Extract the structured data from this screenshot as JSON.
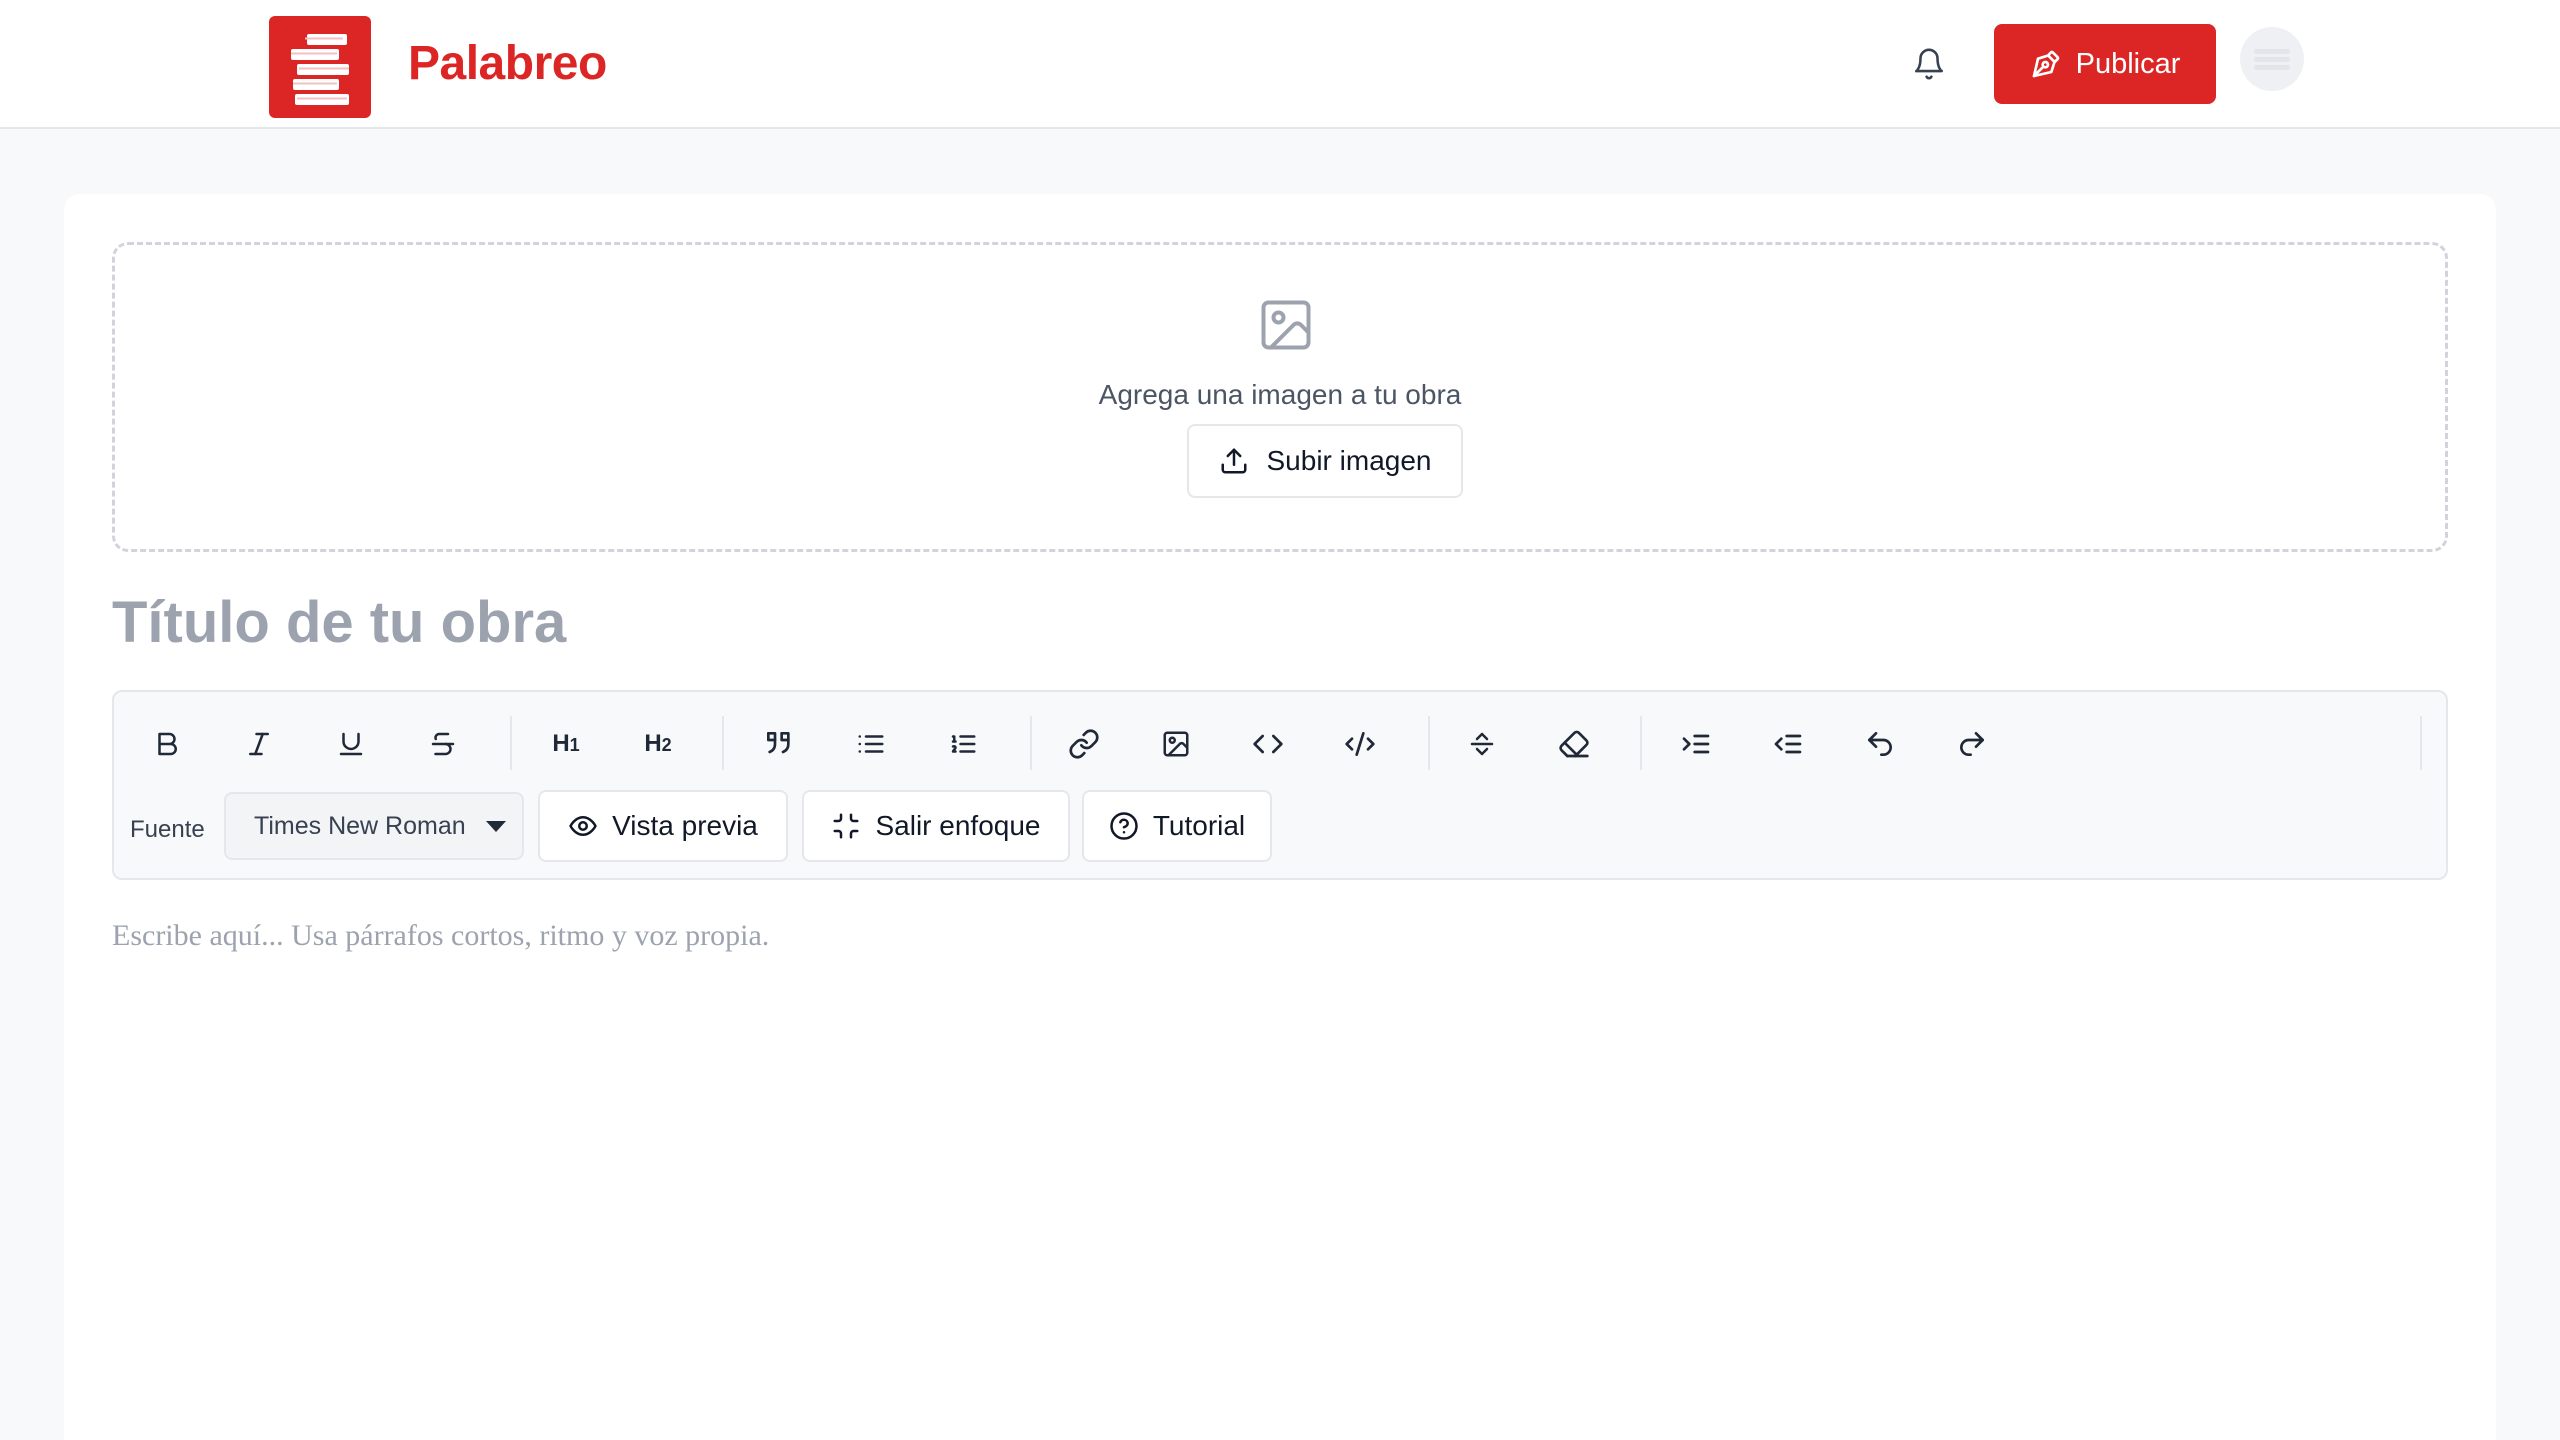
{
  "app": {
    "brand": "Palabreo",
    "accent": "#dc2626"
  },
  "header": {
    "publish_label": "Publicar"
  },
  "dropzone": {
    "text": "Agrega una imagen a tu obra",
    "upload_label": "Subir imagen"
  },
  "editor": {
    "title_placeholder": "Título de tu obra",
    "body_placeholder": "Escribe aquí... Usa párrafos cortos, ritmo y voz propia."
  },
  "toolbar": {
    "buttons": [
      "bold-icon",
      "italic-icon",
      "underline-icon",
      "strikethrough-icon",
      "heading-1-icon",
      "heading-2-icon",
      "quote-icon",
      "bullet-list-icon",
      "numbered-list-icon",
      "link-icon",
      "image-icon",
      "code-inline-icon",
      "code-block-icon",
      "horizontal-rule-icon",
      "eraser-icon",
      "indent-icon",
      "outdent-icon",
      "undo-icon",
      "redo-icon"
    ],
    "h1_label": "H",
    "h1_sub": "1",
    "h2_label": "H",
    "h2_sub": "2",
    "font_label": "Fuente",
    "font_value": "Times New Roman",
    "preview_label": "Vista previa",
    "focus_label": "Salir enfoque",
    "tutorial_label": "Tutorial"
  }
}
